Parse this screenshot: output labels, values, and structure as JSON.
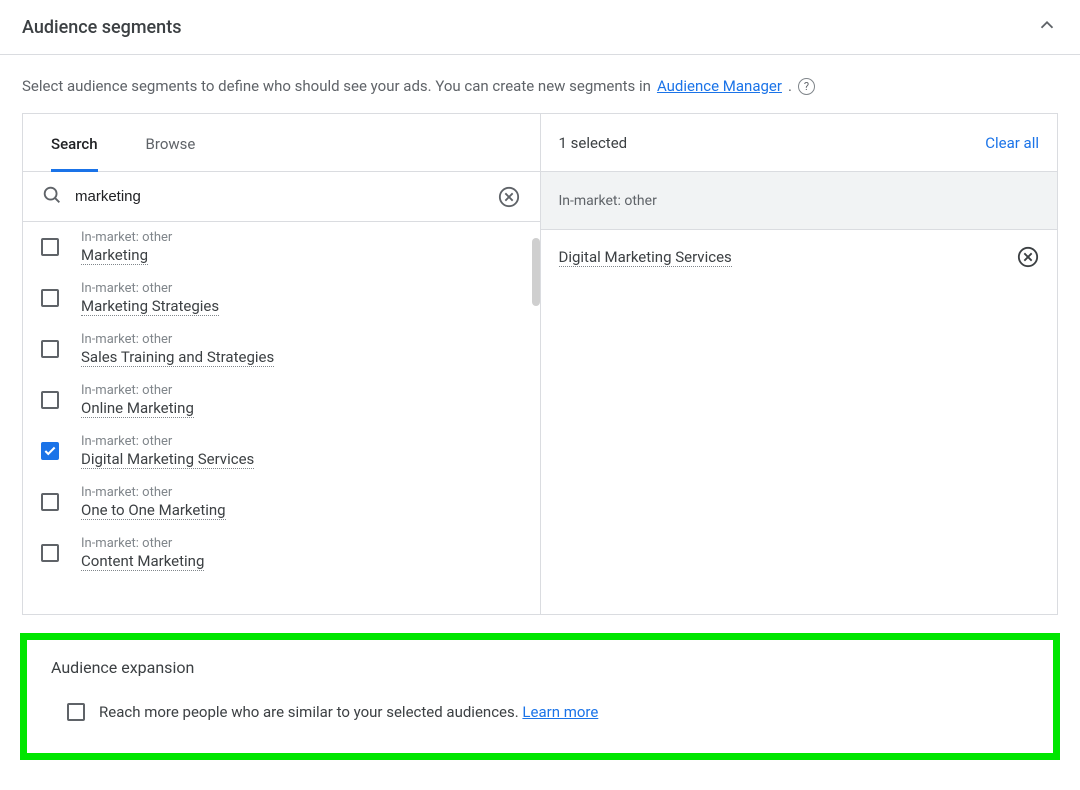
{
  "header": {
    "title": "Audience segments"
  },
  "intro": {
    "text_before": "Select audience segments to define who should see your ads. You can create new segments in ",
    "link_text": "Audience Manager",
    "text_after": "."
  },
  "tabs": {
    "search": "Search",
    "browse": "Browse"
  },
  "search": {
    "value": "marketing"
  },
  "results": [
    {
      "category": "In-market: other",
      "label": "Marketing",
      "checked": false
    },
    {
      "category": "In-market: other",
      "label": "Marketing Strategies",
      "checked": false
    },
    {
      "category": "In-market: other",
      "label": "Sales Training and Strategies",
      "checked": false
    },
    {
      "category": "In-market: other",
      "label": "Online Marketing",
      "checked": false
    },
    {
      "category": "In-market: other",
      "label": "Digital Marketing Services",
      "checked": true
    },
    {
      "category": "In-market: other",
      "label": "One to One Marketing",
      "checked": false
    },
    {
      "category": "In-market: other",
      "label": "Content Marketing",
      "checked": false
    }
  ],
  "selectedPanel": {
    "count_label": "1 selected",
    "clear_all": "Clear all",
    "group_header": "In-market: other",
    "items": [
      {
        "label": "Digital Marketing Services"
      }
    ]
  },
  "expansion": {
    "title": "Audience expansion",
    "text": "Reach more people who are similar to your selected audiences. ",
    "learn_more": "Learn more",
    "checked": false
  }
}
